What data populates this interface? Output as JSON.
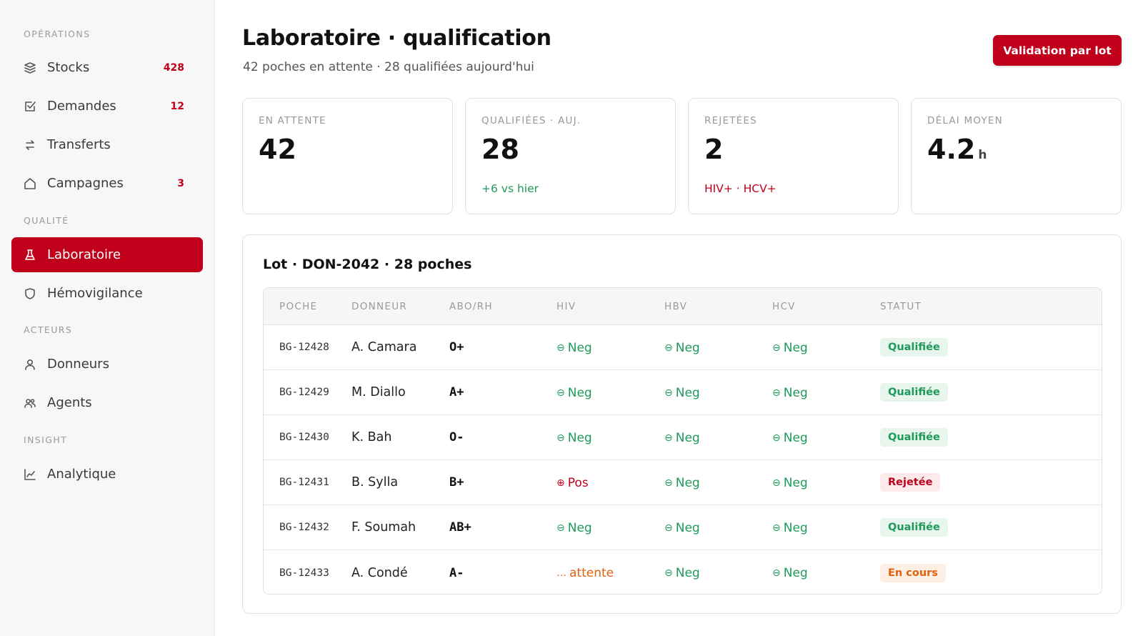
{
  "sidebar": {
    "sections": [
      {
        "label": "OPÉRATIONS",
        "items": [
          {
            "label": "Stocks",
            "icon": "stack-icon",
            "count": "428"
          },
          {
            "label": "Demandes",
            "icon": "checklist-icon",
            "count": "12"
          },
          {
            "label": "Transferts",
            "icon": "transfer-icon",
            "count": ""
          },
          {
            "label": "Campagnes",
            "icon": "home-icon",
            "count": "3"
          }
        ]
      },
      {
        "label": "QUALITÉ",
        "items": [
          {
            "label": "Laboratoire",
            "icon": "flask-icon",
            "count": "",
            "active": true
          },
          {
            "label": "Hémovigilance",
            "icon": "shield-icon",
            "count": ""
          }
        ]
      },
      {
        "label": "ACTEURS",
        "items": [
          {
            "label": "Donneurs",
            "icon": "user-icon",
            "count": ""
          },
          {
            "label": "Agents",
            "icon": "users-icon",
            "count": ""
          }
        ]
      },
      {
        "label": "INSIGHT",
        "items": [
          {
            "label": "Analytique",
            "icon": "chart-icon",
            "count": ""
          }
        ]
      }
    ]
  },
  "header": {
    "title": "Laboratoire · qualification",
    "subtitle": "42 poches en attente · 28 qualifiées aujourd'hui",
    "action_label": "Validation par lot"
  },
  "stats": [
    {
      "label": "EN ATTENTE",
      "value": "42",
      "unit": "",
      "note": "",
      "note_tone": ""
    },
    {
      "label": "QUALIFIÉES · AUJ.",
      "value": "28",
      "unit": "",
      "note": "+6 vs hier",
      "note_tone": "green"
    },
    {
      "label": "REJETÉES",
      "value": "2",
      "unit": "",
      "note": "HIV+ · HCV+",
      "note_tone": "red"
    },
    {
      "label": "DÉLAI MOYEN",
      "value": "4.2",
      "unit": "h",
      "note": "",
      "note_tone": ""
    }
  ],
  "lot": {
    "title": "Lot · DON-2042 · 28 poches",
    "columns": [
      "POCHE",
      "DONNEUR",
      "ABO/RH",
      "HIV",
      "HBV",
      "HCV",
      "STATUT"
    ],
    "rows": [
      {
        "poche": "BG-12428",
        "donneur": "A. Camara",
        "abo": "O+",
        "hiv": {
          "text": "Neg",
          "tone": "neg"
        },
        "hbv": {
          "text": "Neg",
          "tone": "neg"
        },
        "hcv": {
          "text": "Neg",
          "tone": "neg"
        },
        "statut": {
          "text": "Qualifiée",
          "tone": "ok"
        }
      },
      {
        "poche": "BG-12429",
        "donneur": "M. Diallo",
        "abo": "A+",
        "hiv": {
          "text": "Neg",
          "tone": "neg"
        },
        "hbv": {
          "text": "Neg",
          "tone": "neg"
        },
        "hcv": {
          "text": "Neg",
          "tone": "neg"
        },
        "statut": {
          "text": "Qualifiée",
          "tone": "ok"
        }
      },
      {
        "poche": "BG-12430",
        "donneur": "K. Bah",
        "abo": "O-",
        "hiv": {
          "text": "Neg",
          "tone": "neg"
        },
        "hbv": {
          "text": "Neg",
          "tone": "neg"
        },
        "hcv": {
          "text": "Neg",
          "tone": "neg"
        },
        "statut": {
          "text": "Qualifiée",
          "tone": "ok"
        }
      },
      {
        "poche": "BG-12431",
        "donneur": "B. Sylla",
        "abo": "B+",
        "hiv": {
          "text": "Pos",
          "tone": "pos"
        },
        "hbv": {
          "text": "Neg",
          "tone": "neg"
        },
        "hcv": {
          "text": "Neg",
          "tone": "neg"
        },
        "statut": {
          "text": "Rejetée",
          "tone": "rej"
        }
      },
      {
        "poche": "BG-12432",
        "donneur": "F. Soumah",
        "abo": "AB+",
        "hiv": {
          "text": "Neg",
          "tone": "neg"
        },
        "hbv": {
          "text": "Neg",
          "tone": "neg"
        },
        "hcv": {
          "text": "Neg",
          "tone": "neg"
        },
        "statut": {
          "text": "Qualifiée",
          "tone": "ok"
        }
      },
      {
        "poche": "BG-12433",
        "donneur": "A. Condé",
        "abo": "A-",
        "hiv": {
          "text": "attente",
          "tone": "wait"
        },
        "hbv": {
          "text": "Neg",
          "tone": "neg"
        },
        "hcv": {
          "text": "Neg",
          "tone": "neg"
        },
        "statut": {
          "text": "En cours",
          "tone": "run"
        }
      }
    ]
  },
  "colors": {
    "accent": "#c0001a",
    "success": "#1e9a5a",
    "warning": "#e0610e"
  }
}
